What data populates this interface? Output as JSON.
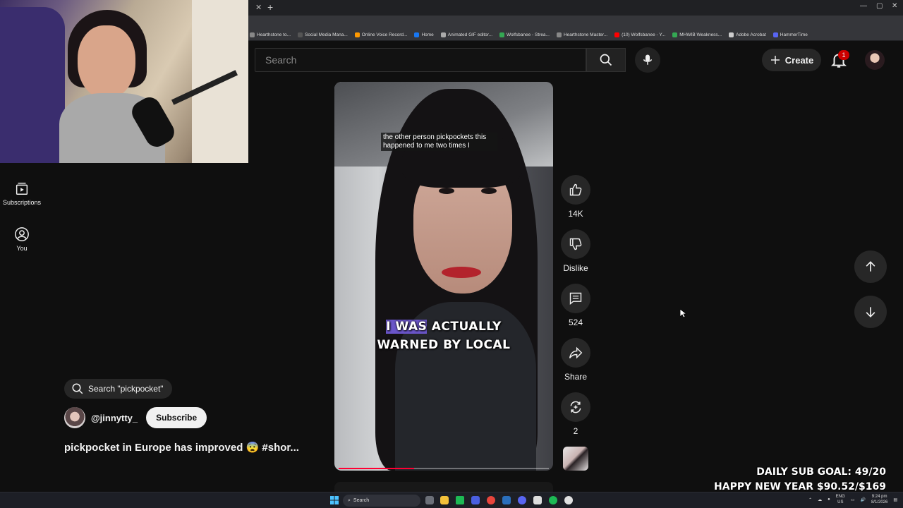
{
  "browser": {
    "bookmarks": [
      {
        "label": "Hearthstone to...",
        "color": "#888888"
      },
      {
        "label": "Social Media Mana...",
        "color": "#555555"
      },
      {
        "label": "Online Voice Record...",
        "color": "#ff9900"
      },
      {
        "label": "Home",
        "color": "#1877f2"
      },
      {
        "label": "Animated GIF editor...",
        "color": "#aaaaaa"
      },
      {
        "label": "Wolfsbanee - Strea...",
        "color": "#34a853"
      },
      {
        "label": "Hearthstone Master...",
        "color": "#888888"
      },
      {
        "label": "(10) Wolfsbanee - Y...",
        "color": "#ff0000"
      },
      {
        "label": "MHWIB Weakness...",
        "color": "#34a853"
      },
      {
        "label": "Adobe Acrobat",
        "color": "#cccccc"
      },
      {
        "label": "HammerTime",
        "color": "#5865f2"
      }
    ]
  },
  "sidebar": {
    "items": [
      {
        "label": "Subscriptions",
        "icon": "subscriptions-icon"
      },
      {
        "label": "You",
        "icon": "account-icon"
      }
    ]
  },
  "masthead": {
    "search_placeholder": "Search",
    "create_label": "Create",
    "notification_count": "1"
  },
  "video": {
    "caption": "the other person pickpockets this happened to me two times I",
    "overlay_highlight": "I WAS",
    "overlay_rest": " ACTUALLY",
    "overlay_line2": "WARNED BY LOCAL",
    "progress": 0.36
  },
  "actions": {
    "like_count": "14K",
    "dislike_label": "Dislike",
    "comment_count": "524",
    "share_label": "Share",
    "remix_count": "2"
  },
  "metadata": {
    "search_chip": "Search \"pickpocket\"",
    "channel_name": "@jinnytty_",
    "subscribe_label": "Subscribe",
    "title": "pickpocket in Europe has improved 😨 #shor..."
  },
  "overlay": {
    "sub_goal": "DAILY SUB GOAL: 49/20",
    "new_year": "HAPPY NEW YEAR $90.52/$169"
  },
  "taskbar": {
    "search_label": "Search",
    "lang_top": "ENG",
    "lang_bottom": "US",
    "time": "9:24 pm",
    "date": "8/1/2026"
  },
  "colors": {
    "accent_red": "#ff0033",
    "caption_highlight": "#6a55c9",
    "badge": "#cc0000"
  }
}
